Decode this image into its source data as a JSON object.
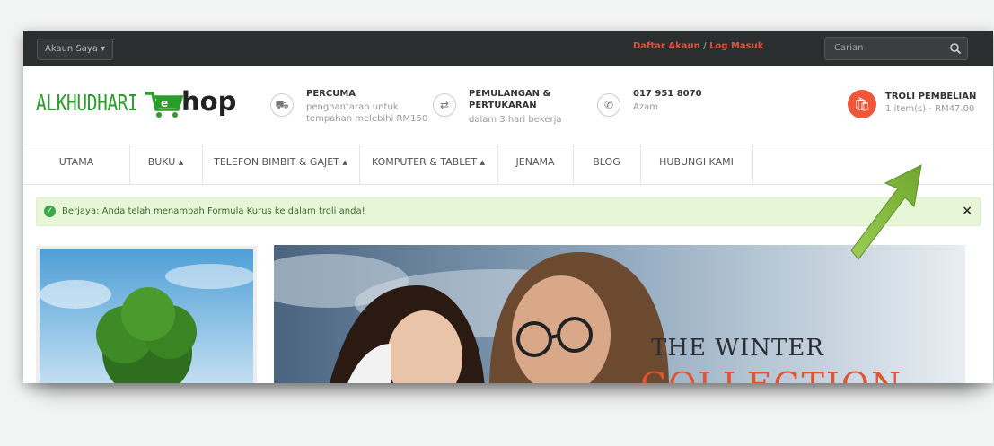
{
  "topbar": {
    "account_label": "Akaun Saya ▾",
    "register_label": "Daftar Akaun",
    "separator": "/",
    "login_label": "Log Masuk",
    "search_placeholder": "Carian"
  },
  "header": {
    "logo_text_left": "ALKHUDHARI",
    "logo_text_e": "e",
    "logo_text_right": "hop",
    "info": [
      {
        "icon": "truck-icon",
        "title": "PERCUMA",
        "line1": "penghantaran untuk",
        "line2": "tempahan melebihi RM150"
      },
      {
        "icon": "exchange-icon",
        "title": "PEMULANGAN &",
        "title2": "PERTUKARAN",
        "line1": "dalam 3 hari bekerja"
      },
      {
        "icon": "phone-icon",
        "title": "017 951 8070",
        "line1": "Azam"
      }
    ],
    "cart": {
      "title": "TROLI PEMBELIAN",
      "summary": "1 item(s) - RM47.00"
    }
  },
  "nav": {
    "items": [
      "UTAMA",
      "BUKU ▴",
      "TELEFON BIMBIT & GAJET ▴",
      "KOMPUTER & TABLET ▴",
      "JENAMA",
      "BLOG",
      "HUBUNGI KAMI"
    ]
  },
  "alert": {
    "message": "Berjaya: Anda telah menambah Formula Kurus ke dalam troli anda!",
    "close": "×"
  },
  "hero": {
    "line1": "THE WINTER",
    "line2": "COLLECTION"
  },
  "colors": {
    "accent_red": "#e74c3c",
    "cart_orange": "#f0563a",
    "success_bg": "#e8f6d8",
    "topbar_bg": "#2b2e2f",
    "logo_green": "#2a9d2a"
  }
}
